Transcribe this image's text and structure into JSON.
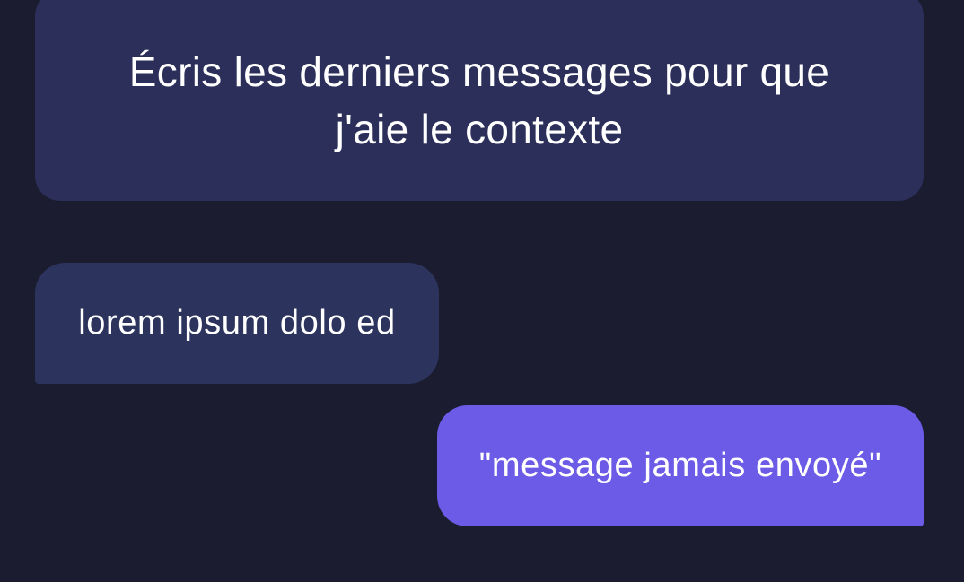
{
  "conversation": {
    "prompt": "Écris les derniers messages pour que j'aie le contexte",
    "messages": [
      {
        "direction": "received",
        "text": "lorem ipsum dolo ed"
      },
      {
        "direction": "sent",
        "text": "\"message jamais envoyé\""
      }
    ]
  },
  "colors": {
    "background": "#1b1c30",
    "prompt_card": "#2b2f59",
    "received_bubble": "#2c335d",
    "sent_bubble": "#6b5be6",
    "text": "#ffffff"
  }
}
